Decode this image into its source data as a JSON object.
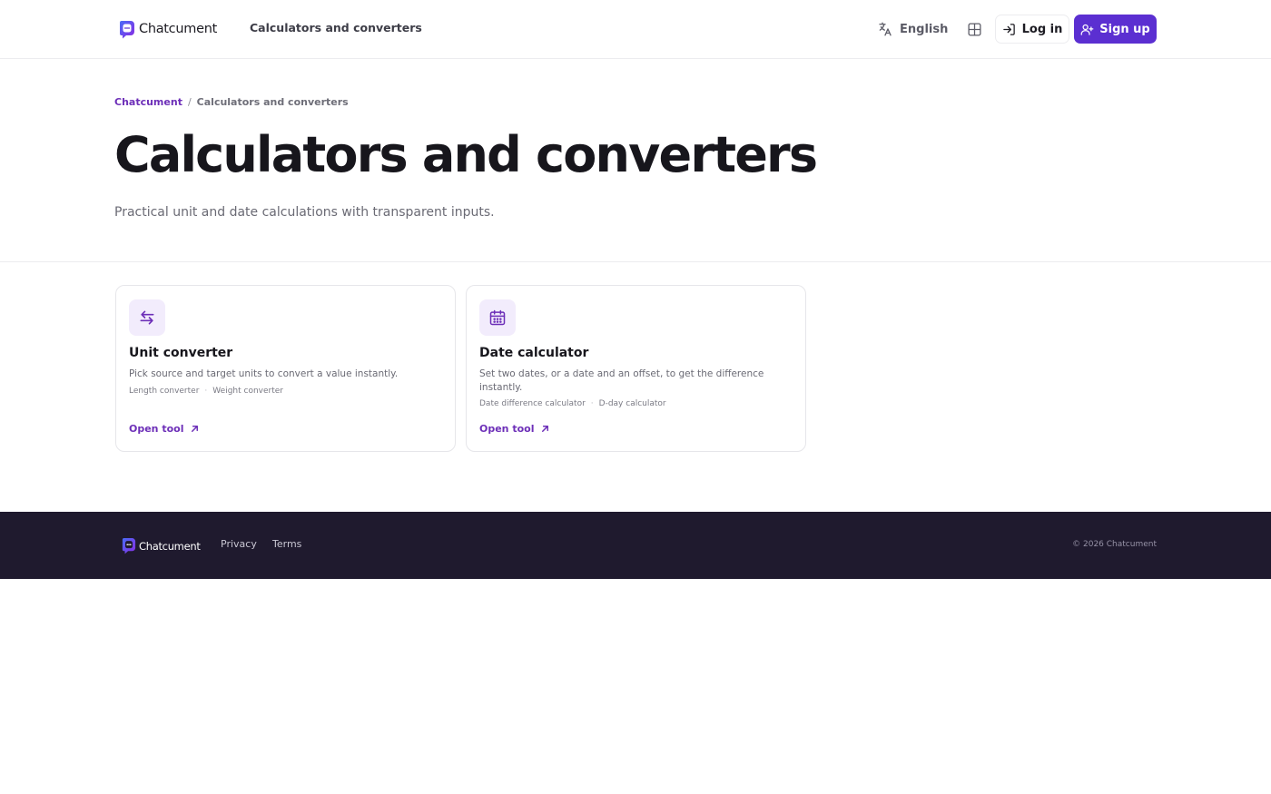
{
  "header": {
    "logo_text": "Chatcument",
    "nav_link": "Calculators and converters",
    "language": "English",
    "login_label": "Log in",
    "signup_label": "Sign up",
    "icons": [
      "translate-icon",
      "grid-icon",
      "login-icon",
      "user-plus-icon"
    ]
  },
  "breadcrumb": {
    "home": "Chatcument",
    "separator": "/",
    "current": "Calculators and converters"
  },
  "hero": {
    "title": "Calculators and converters",
    "subtitle": "Practical unit and date calculations with transparent inputs."
  },
  "cards": [
    {
      "icon": "arrows-swap-icon",
      "title": "Unit converter",
      "description": "Pick source and target units to convert a value instantly.",
      "tags": [
        "Length converter",
        "Weight converter"
      ],
      "link_label": "Open tool"
    },
    {
      "icon": "calendar-icon",
      "title": "Date calculator",
      "description": "Set two dates, or a date and an offset, to get the difference instantly.",
      "tags": [
        "Date difference calculator",
        "D-day calculator"
      ],
      "link_label": "Open tool"
    }
  ],
  "footer": {
    "logo_text": "Chatcument",
    "privacy": "Privacy",
    "terms": "Terms",
    "copyright": "© 2026 Chatcument"
  },
  "colors": {
    "accent": "#5b2fd1",
    "link": "#6d2fb8",
    "icon_bg": "#f2ecfc",
    "footer_bg": "#1f1a2e"
  }
}
